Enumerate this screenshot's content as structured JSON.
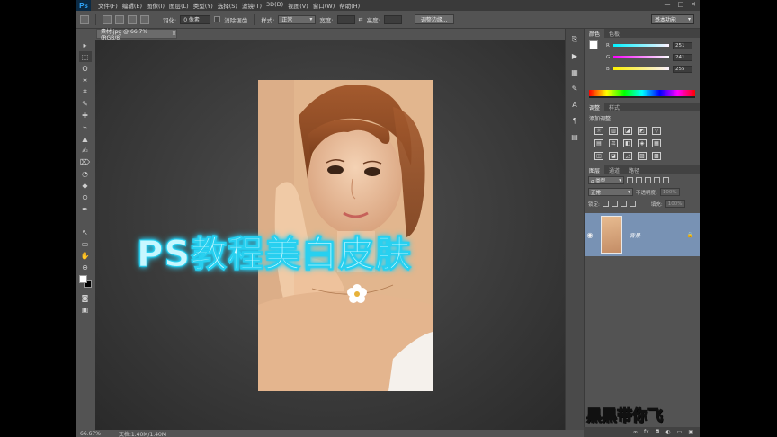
{
  "app": {
    "logo": "Ps"
  },
  "menu": [
    "文件(F)",
    "编辑(E)",
    "图像(I)",
    "图层(L)",
    "类型(Y)",
    "选择(S)",
    "滤镜(T)",
    "3D(D)",
    "视图(V)",
    "窗口(W)",
    "帮助(H)"
  ],
  "window_controls": [
    "—",
    "□",
    "✕"
  ],
  "options": {
    "feather_label": "羽化:",
    "feather_value": "0 像素",
    "antialias_label": "消除锯齿",
    "style_label": "样式:",
    "style_value": "正常",
    "width_label": "宽度:",
    "height_label": "高度:",
    "refine_button": "调整边缘...",
    "workspace": "基本功能"
  },
  "document": {
    "tab_label": "素材.jpg @ 66.7%(RGB/8)",
    "close": "×",
    "status_zoom": "66.67%",
    "status_doc": "文档:1.40M/1.40M"
  },
  "overlay_title": "PS教程美白皮肤",
  "color_panel": {
    "tabs": [
      "颜色",
      "色板"
    ],
    "sliders": [
      {
        "letter": "R",
        "value": "251",
        "gradient": "linear-gradient(90deg,#00f2ff,#fff2ff)"
      },
      {
        "letter": "G",
        "value": "241",
        "gradient": "linear-gradient(90deg,#fb00ff,#fbffff)"
      },
      {
        "letter": "B",
        "value": "255",
        "gradient": "linear-gradient(90deg,#fbf100,#fbf1ff)"
      }
    ]
  },
  "adjustments_panel": {
    "tabs": [
      "调整",
      "样式"
    ],
    "heading": "添加调整",
    "row1": [
      "☼",
      "▥",
      "◪",
      "◩",
      "▽"
    ],
    "row2": [
      "▤",
      "⚖",
      "◧",
      "◈",
      "▦"
    ],
    "row3": [
      "◫",
      "◪",
      "◿",
      "▨",
      "▩"
    ]
  },
  "layers_panel": {
    "tabs": [
      "图层",
      "通道",
      "路径"
    ],
    "filter_label": "ρ 类型",
    "blend_mode": "正常",
    "opacity_label": "不透明度:",
    "opacity_value": "100%",
    "lock_label": "锁定:",
    "fill_label": "填充:",
    "fill_value": "100%",
    "layer_name": "背景",
    "lock_glyph": "🔒"
  },
  "panel_footer": [
    "∞",
    "fx",
    "◘",
    "◐",
    "▭",
    "▣",
    "🗑"
  ],
  "watermark": "黑黑带你飞",
  "tools": [
    "▸",
    "⬚",
    "ʘ",
    "✶",
    "⌗",
    "✎",
    "✚",
    "⌁",
    "▲",
    "✍",
    "⌦",
    "◔",
    "◆",
    "⊙",
    "✒",
    "T",
    "↖",
    "▭",
    "✋",
    "⊕"
  ]
}
